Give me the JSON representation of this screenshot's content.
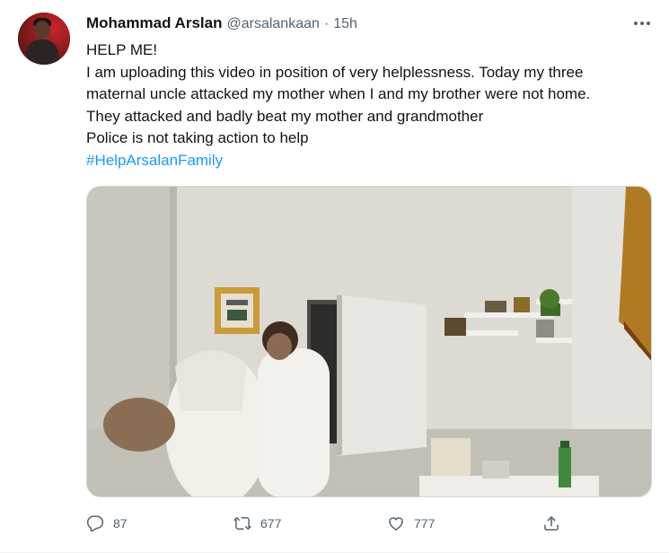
{
  "tweet": {
    "author_name": "Mohammad Arslan",
    "author_handle": "@arsalankaan",
    "separator": "·",
    "timestamp": "15h",
    "lines": [
      "HELP ME!",
      "I am uploading this video in position of very helplessness. Today my three",
      "maternal uncle attacked my mother when I and my brother were not home.",
      "They attacked and badly beat my mother and grandmother",
      "Police is not taking action to help"
    ],
    "hashtag": "#HelpArsalanFamily",
    "media": {
      "kind": "video-thumbnail",
      "alt": ""
    },
    "stats": {
      "replies": "87",
      "retweets": "677",
      "likes": "777"
    }
  },
  "colors": {
    "text": "#0f1419",
    "secondary": "#536471",
    "link": "#1d9bf0"
  },
  "icons": {
    "more": "more-dots-icon",
    "reply": "reply-bubble-icon",
    "retweet": "retweet-icon",
    "like": "heart-icon",
    "share": "share-upload-icon"
  }
}
